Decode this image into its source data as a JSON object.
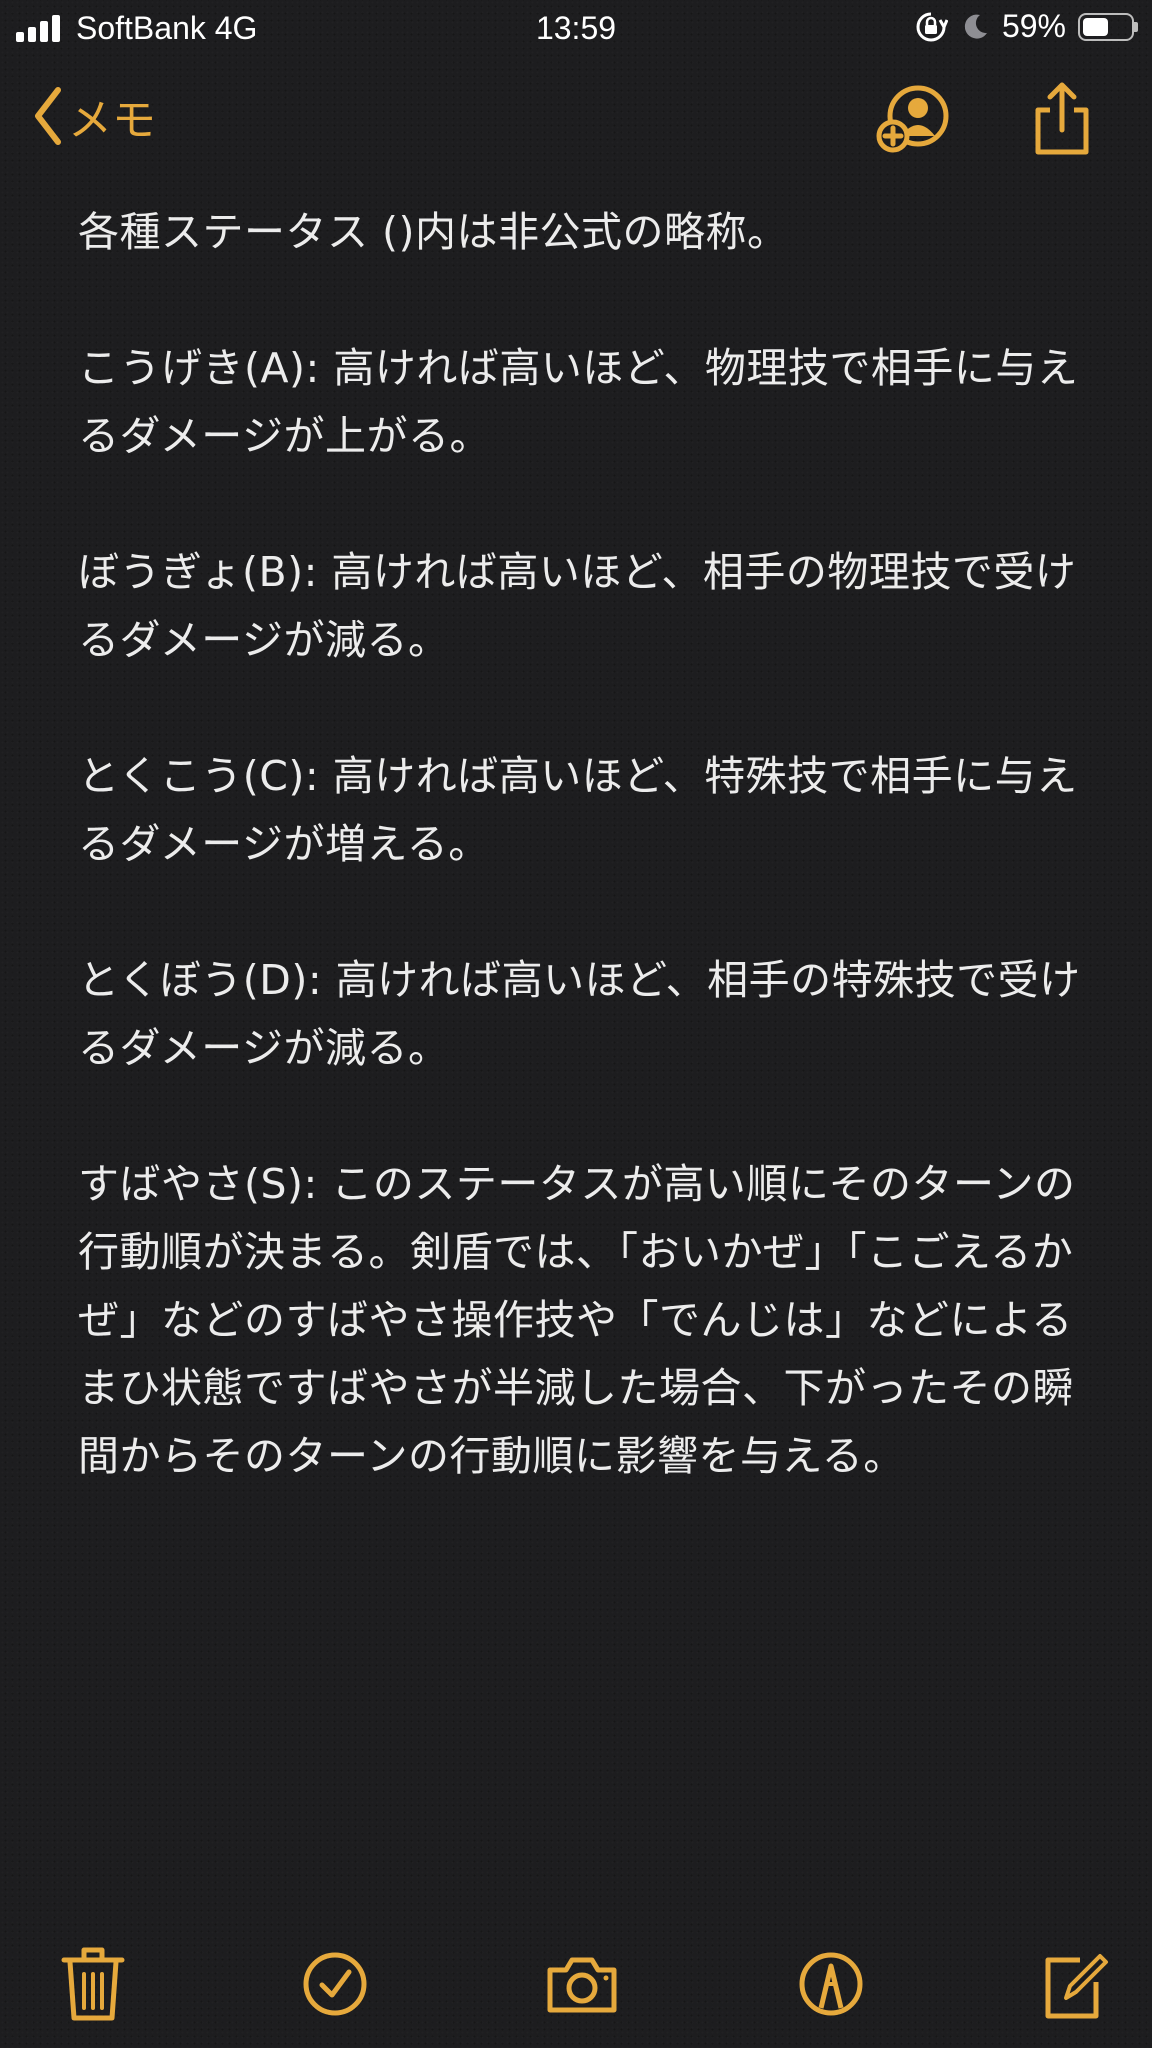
{
  "status_bar": {
    "carrier": "SoftBank 4G",
    "time": "13:59",
    "battery_percent": "59%",
    "battery_level": 0.59
  },
  "nav": {
    "back_label": "メモ",
    "icons": [
      "chevron-left-icon",
      "add-person-icon",
      "share-icon"
    ]
  },
  "note": {
    "text": "各種ステータス ()内は非公式の略称。\n\nこうげき(A): 高ければ高いほど、物理技で相手に与えるダメージが上がる。\n\nぼうぎょ(B): 高ければ高いほど、相手の物理技で受けるダメージが減る。\n\nとくこう(C): 高ければ高いほど、特殊技で相手に与えるダメージが増える。\n\nとくぼう(D): 高ければ高いほど、相手の特殊技で受けるダメージが減る。\n\nすばやさ(S): このステータスが高い順にそのターンの行動順が決まる。剣盾では、「おいかぜ」「こごえるかぜ」などのすばやさ操作技や「でんじは」などによるまひ状態ですばやさが半減した場合、下がったその瞬間からそのターンの行動順に影響を与える。"
  },
  "toolbar": {
    "icons": [
      "trash-icon",
      "checklist-icon",
      "camera-icon",
      "markup-icon",
      "compose-icon"
    ]
  },
  "colors": {
    "accent": "#e6a93c",
    "background": "#1d1d1f",
    "text": "#ececec"
  }
}
